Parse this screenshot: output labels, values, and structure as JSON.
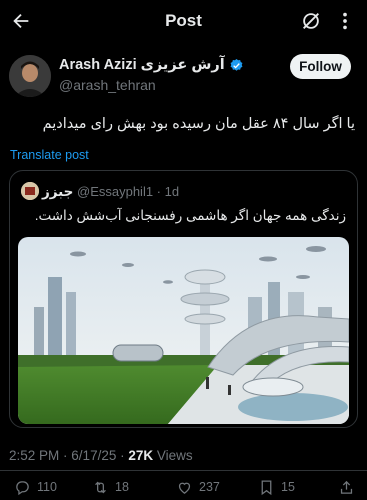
{
  "header": {
    "title": "Post"
  },
  "author": {
    "name": "Arash Azizi",
    "name_fa": "آرش عزیزی",
    "handle": "@arash_tehran",
    "verified": true,
    "follow_label": "Follow"
  },
  "post": {
    "text": "یا اگر سال ۸۴ عقل مان رسیده بود بهش رای میدادیم",
    "translate_label": "Translate post"
  },
  "quote": {
    "name": "جبزز",
    "handle_time": "@Essayphil1 · 1d",
    "text": "زندگی همه جهان اگر هاشمی رفسنجانی آب‌شش داشت.",
    "image": "futuristic-city-illustration"
  },
  "meta": {
    "time": "2:52 PM",
    "date": "6/17/25",
    "views_count": "27K",
    "views_label": "Views"
  },
  "actions": {
    "replies": "110",
    "reposts": "18",
    "likes": "237",
    "bookmarks": "15"
  },
  "colors": {
    "background": "#000000",
    "text": "#e7e9ea",
    "secondary": "#71767b",
    "accent": "#1d9bf0",
    "border": "#2f3336"
  }
}
